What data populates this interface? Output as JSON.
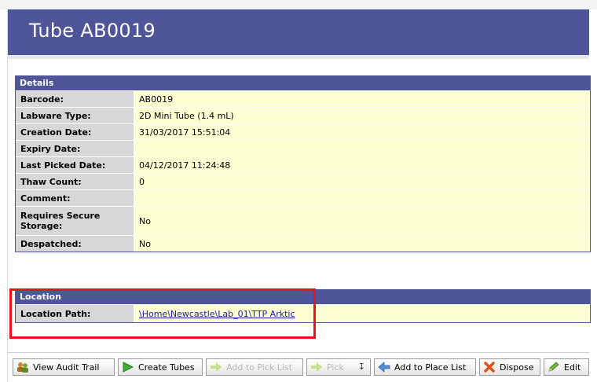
{
  "header": {
    "title": "Tube AB0019"
  },
  "details": {
    "heading": "Details",
    "rows": [
      {
        "label": "Barcode:",
        "value": "AB0019"
      },
      {
        "label": "Labware Type:",
        "value": "2D Mini Tube (1.4 mL)"
      },
      {
        "label": "Creation Date:",
        "value": "31/03/2017 15:51:04"
      },
      {
        "label": "Expiry Date:",
        "value": ""
      },
      {
        "label": "Last Picked Date:",
        "value": "04/12/2017 11:24:48"
      },
      {
        "label": "Thaw Count:",
        "value": "0"
      },
      {
        "label": "Comment:",
        "value": ""
      },
      {
        "label": "Requires Secure Storage:",
        "value": "No"
      },
      {
        "label": "Despatched:",
        "value": "No"
      }
    ]
  },
  "location": {
    "heading": "Location",
    "path_label": "Location Path:",
    "path_value": "\\Home\\Newcastle\\Lab_01\\TTP Arktic"
  },
  "toolbar": {
    "view_audit_trail": "View Audit Trail",
    "create_tubes": "Create Tubes",
    "add_to_pick_list": "Add to Pick List",
    "pick": "Pick",
    "add_to_place_list": "Add to Place List",
    "dispose": "Dispose",
    "edit": "Edit"
  },
  "colors": {
    "header": "#4e5699",
    "label_bg": "#d7d7d7",
    "value_bg": "#ffffd4",
    "highlight": "#e8141c"
  }
}
